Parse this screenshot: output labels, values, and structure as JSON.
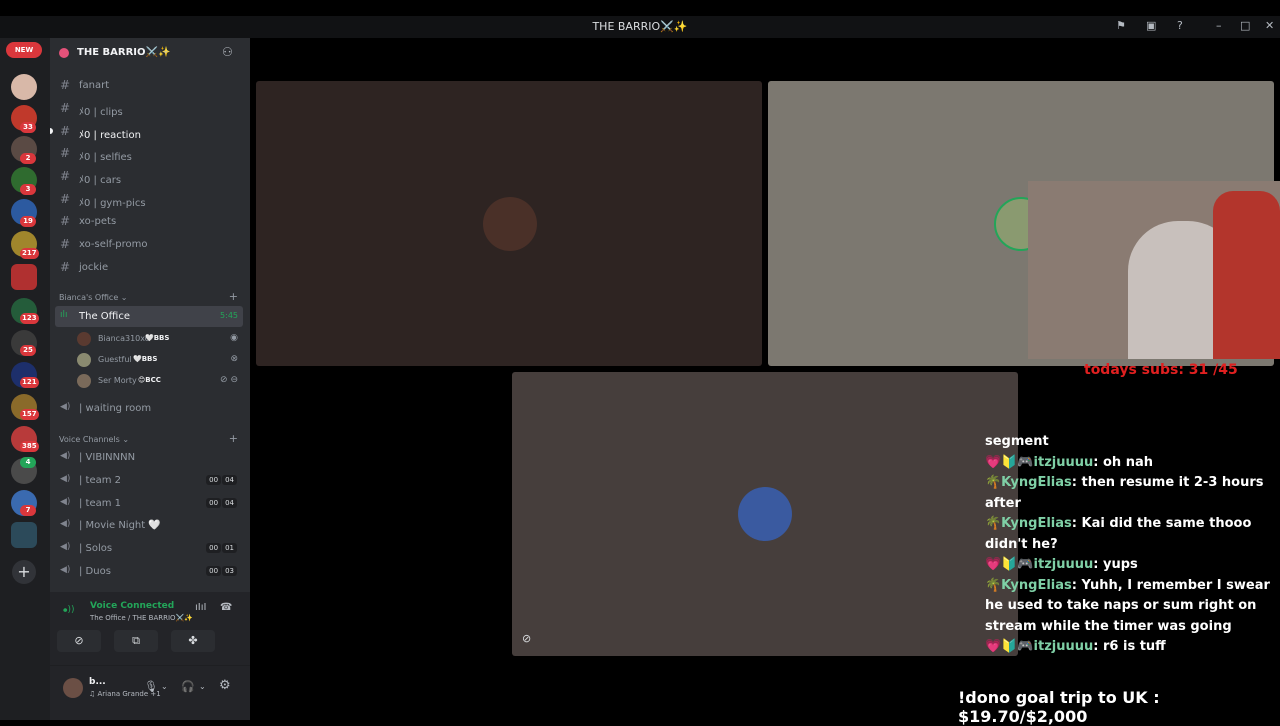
{
  "window": {
    "title": "THE BARRIO⚔️✨"
  },
  "servers": {
    "new_label": "NEW",
    "badges": [
      "33",
      "2",
      "3",
      "19",
      "217",
      "123",
      "25",
      "121",
      "157",
      "385",
      "4",
      "7"
    ]
  },
  "guild": {
    "name": "THE BARRIO⚔️✨"
  },
  "channels": {
    "text": [
      {
        "name": "fanart"
      },
      {
        "name": "ﾒ0 | clips"
      },
      {
        "name": "ﾒ0 | reaction"
      },
      {
        "name": "ﾒ0 | selfies"
      },
      {
        "name": "ﾒ0 | cars"
      },
      {
        "name": "ﾒ0 | gym-pics"
      },
      {
        "name": "xo-pets"
      },
      {
        "name": "xo-self-promo"
      },
      {
        "name": "jockie"
      }
    ],
    "office_category": "Bianca's Office",
    "active_voice": {
      "name": "The Office",
      "time": "5:45"
    },
    "voice_users": [
      {
        "name": "Bianca310xo",
        "tag": "🤍BBS"
      },
      {
        "name": "Guestful",
        "tag": "🤍BBS"
      },
      {
        "name": "Ser Morty",
        "tag": "😊BCC"
      }
    ],
    "waiting_room": "| waiting room",
    "voice_category": "Voice Channels",
    "voice": [
      {
        "name": "| VIBINNNN"
      },
      {
        "name": "| team 2",
        "a": "00",
        "b": "04"
      },
      {
        "name": "| team 1",
        "a": "00",
        "b": "04"
      },
      {
        "name": "| Movie Night 🤍"
      },
      {
        "name": "| Solos",
        "a": "00",
        "b": "01"
      },
      {
        "name": "| Duos",
        "a": "00",
        "b": "03"
      }
    ]
  },
  "voice_panel": {
    "status": "Voice Connected",
    "location": "The Office / THE BARRIO⚔️✨"
  },
  "user_panel": {
    "name": "b...",
    "status": "♫ Ariana Grande +1"
  },
  "overlay": {
    "subs": "todays subs: 31 /45",
    "chat": [
      {
        "text": "segment"
      },
      {
        "user": "💗🔰🎮itzjuuuu",
        "text": ": oh nah"
      },
      {
        "user": "🌴KyngElias",
        "text": ": then resume it 2-3 hours after"
      },
      {
        "user": "🌴KyngElias",
        "text": ": Kai did the same thooo didn't he?"
      },
      {
        "user": "💗🔰🎮itzjuuuu",
        "text": ": yups"
      },
      {
        "user": "🌴KyngElias",
        "text": ": Yuhh, I remember I swear he used to take naps or sum right on stream while the timer was going"
      },
      {
        "user": "💗🔰🎮itzjuuuu",
        "text": ": r6 is tuff"
      }
    ],
    "dono": "!dono goal trip to UK : $19.70/$2,000"
  }
}
